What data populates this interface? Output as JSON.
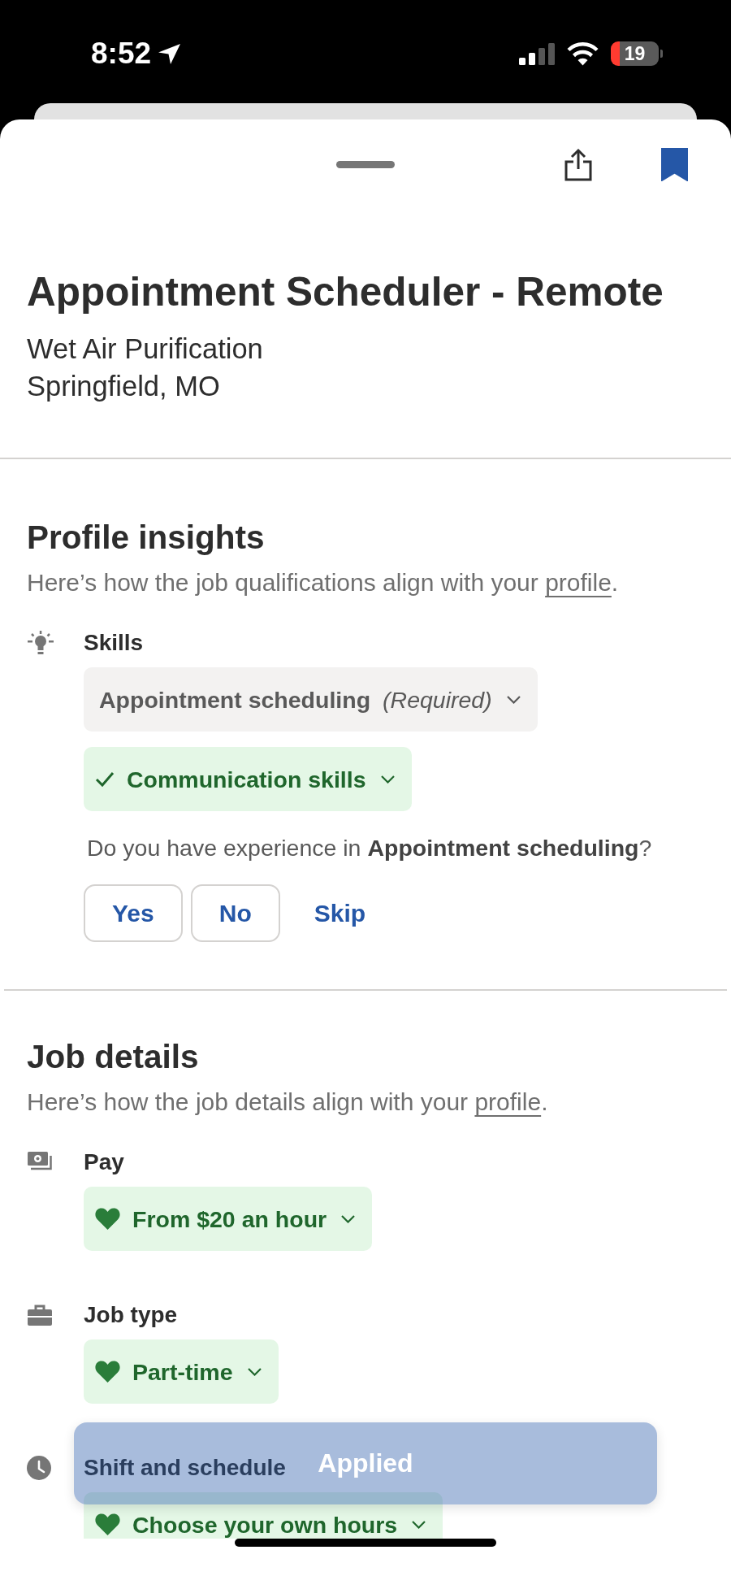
{
  "status_bar": {
    "time": "8:52",
    "battery": "19"
  },
  "sheet": {
    "bookmarked": true
  },
  "job": {
    "title": "Appointment Scheduler - Remote",
    "company": "Wet Air Purification",
    "location": "Springfield, MO"
  },
  "sections": [
    {
      "title": "Profile insights",
      "subtitle": {
        "text": "Here’s how the job qualifications align with your ",
        "link": "profile",
        "end": "."
      },
      "groups": [
        {
          "kind": "skills",
          "label": "Skills",
          "chips": [
            {
              "kind": "skill",
              "text": "Appointment scheduling",
              "note": "(Required)",
              "matched": false
            },
            {
              "kind": "skill",
              "text": "Communication skills",
              "matched": true
            }
          ],
          "question": "Do you have experience in **Appointment scheduling**?",
          "answers": [
            {
              "label": "Yes",
              "kind": "outlined"
            },
            {
              "label": "No",
              "kind": "outlined"
            },
            {
              "label": "Skip",
              "kind": "plain"
            }
          ]
        }
      ]
    },
    {
      "title": "Job details",
      "subtitle": {
        "text": "Here’s how the job details align with your ",
        "link": "profile",
        "end": "."
      },
      "groups": [
        {
          "kind": "pay",
          "label": "Pay",
          "chips": [
            {
              "kind": "preference",
              "text": "From $20 an hour",
              "matched": true
            }
          ]
        },
        {
          "kind": "job_type",
          "label": "Job type",
          "chips": [
            {
              "kind": "preference",
              "text": "Part-time",
              "matched": true
            }
          ]
        },
        {
          "kind": "schedule",
          "label": "Shift and schedule",
          "chips": [
            {
              "kind": "preference",
              "text": "Choose your own hours",
              "matched": true
            }
          ]
        }
      ]
    }
  ],
  "toast": {
    "text": "Applied"
  }
}
